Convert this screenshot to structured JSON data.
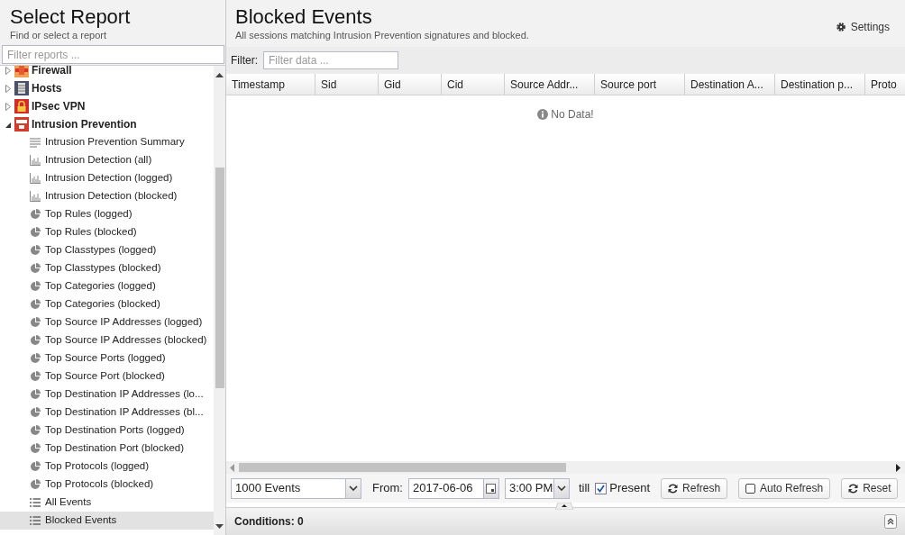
{
  "sidebar": {
    "title": "Select Report",
    "subtitle": "Find or select a report",
    "filter": {
      "placeholder": "Filter reports ..."
    },
    "tree": [
      {
        "label": "Firewall",
        "kind": "firewall",
        "expanded": false
      },
      {
        "label": "Hosts",
        "kind": "hosts",
        "expanded": false
      },
      {
        "label": "IPsec VPN",
        "kind": "vpn",
        "expanded": false
      },
      {
        "label": "Intrusion Prevention",
        "kind": "ips",
        "expanded": true,
        "children": [
          {
            "label": "Intrusion Prevention Summary",
            "kind": "text",
            "selected": false
          },
          {
            "label": "Intrusion Detection (all)",
            "kind": "bar",
            "selected": false
          },
          {
            "label": "Intrusion Detection (logged)",
            "kind": "bar",
            "selected": false
          },
          {
            "label": "Intrusion Detection (blocked)",
            "kind": "bar",
            "selected": false
          },
          {
            "label": "Top Rules (logged)",
            "kind": "pie",
            "selected": false
          },
          {
            "label": "Top Rules (blocked)",
            "kind": "pie",
            "selected": false
          },
          {
            "label": "Top Classtypes (logged)",
            "kind": "pie",
            "selected": false
          },
          {
            "label": "Top Classtypes (blocked)",
            "kind": "pie",
            "selected": false
          },
          {
            "label": "Top Categories (logged)",
            "kind": "pie",
            "selected": false
          },
          {
            "label": "Top Categories (blocked)",
            "kind": "pie",
            "selected": false
          },
          {
            "label": "Top Source IP Addresses (logged)",
            "kind": "pie",
            "selected": false
          },
          {
            "label": "Top Source IP Addresses (blocked)",
            "kind": "pie",
            "selected": false
          },
          {
            "label": "Top Source Ports (logged)",
            "kind": "pie",
            "selected": false
          },
          {
            "label": "Top Source Port (blocked)",
            "kind": "pie",
            "selected": false
          },
          {
            "label": "Top Destination IP Addresses (lo...",
            "kind": "pie",
            "selected": false
          },
          {
            "label": "Top Destination IP Addresses (bl...",
            "kind": "pie",
            "selected": false
          },
          {
            "label": "Top Destination Ports (logged)",
            "kind": "pie",
            "selected": false
          },
          {
            "label": "Top Destination Port (blocked)",
            "kind": "pie",
            "selected": false
          },
          {
            "label": "Top Protocols (logged)",
            "kind": "pie",
            "selected": false
          },
          {
            "label": "Top Protocols (blocked)",
            "kind": "pie",
            "selected": false
          },
          {
            "label": "All Events",
            "kind": "list",
            "selected": false
          },
          {
            "label": "Blocked Events",
            "kind": "list",
            "selected": true
          }
        ]
      }
    ]
  },
  "report": {
    "title": "Blocked Events",
    "subtitle": "All sessions matching Intrusion Prevention signatures and blocked.",
    "settings": "Settings",
    "filter": {
      "label": "Filter:",
      "placeholder": "Filter data ..."
    },
    "table": {
      "columns": [
        "Timestamp",
        "Sid",
        "Gid",
        "Cid",
        "Source Addr...",
        "Source port",
        "Destination A...",
        "Destination p...",
        "Proto"
      ],
      "empty_message": "No Data!"
    },
    "toolbar": {
      "limit": "1000 Events",
      "from_label": "From:",
      "date": "2017-06-06",
      "time": "3:00 PM",
      "till_label": "till",
      "present": {
        "label": "Present",
        "checked": true
      },
      "buttons": [
        {
          "label": "Refresh",
          "kind": "refresh"
        },
        {
          "label": "Auto Refresh",
          "kind": "toggle",
          "checked": false
        },
        {
          "label": "Reset",
          "kind": "refresh"
        }
      ]
    },
    "conditions": "Conditions: 0"
  }
}
